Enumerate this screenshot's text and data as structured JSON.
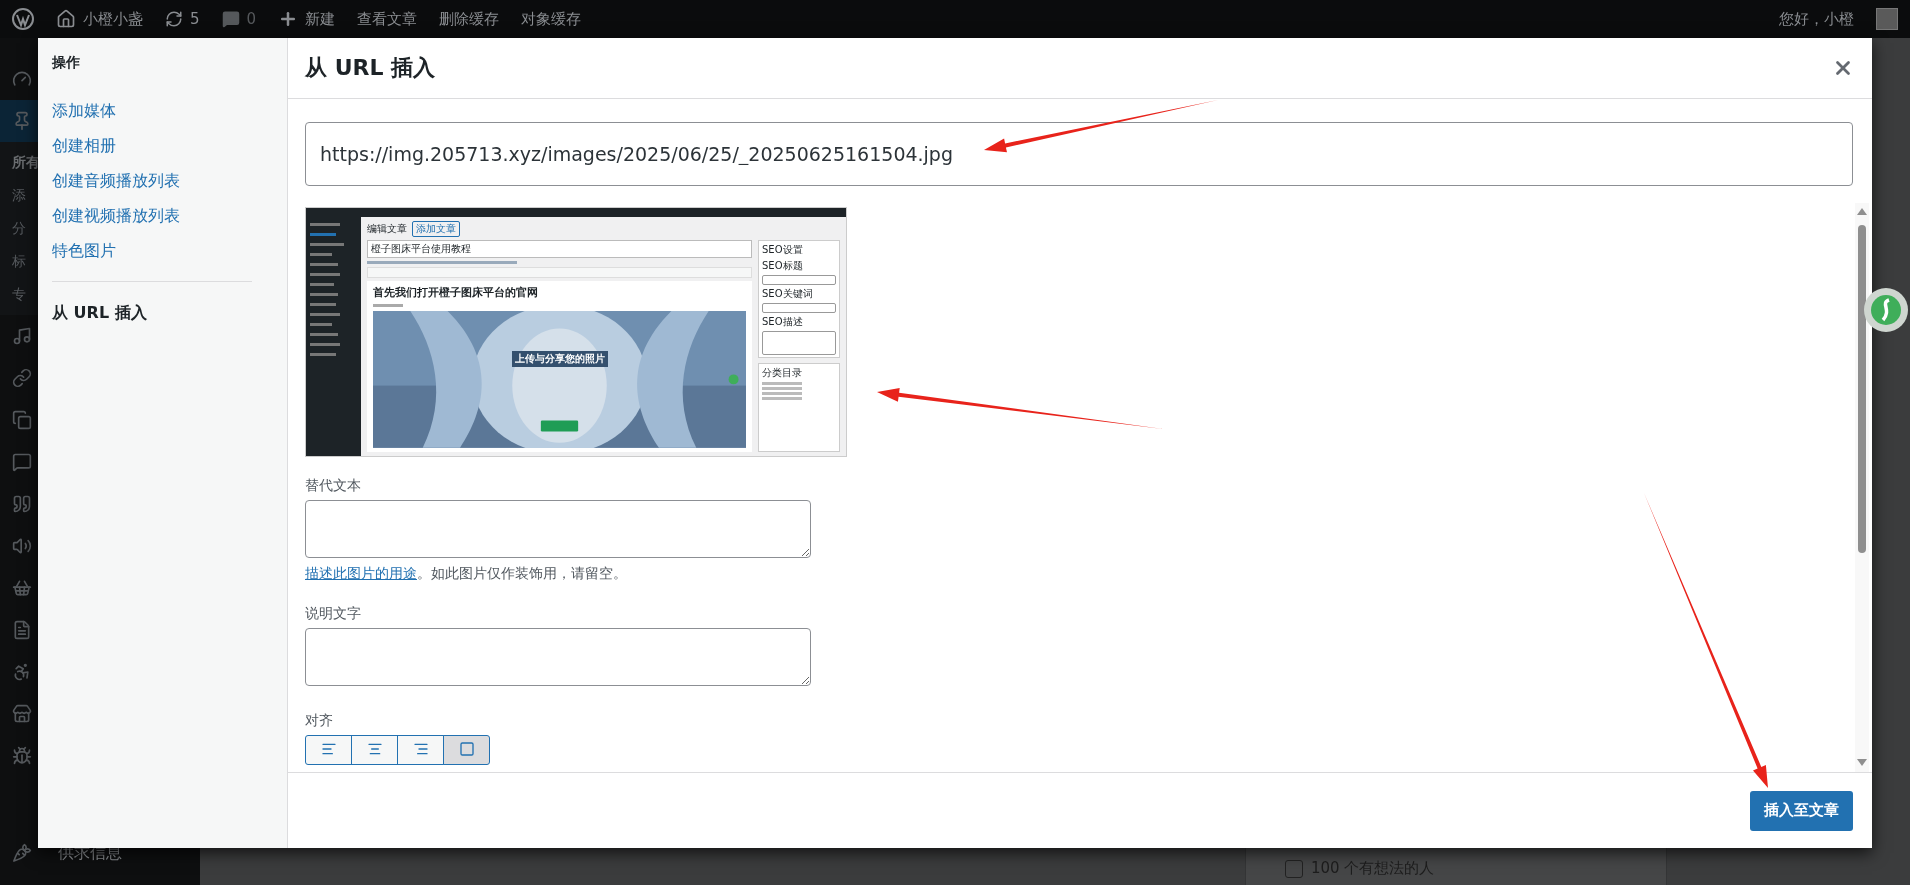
{
  "admin_bar": {
    "site": "小橙小盏",
    "updates": "5",
    "comments": "0",
    "new": "新建",
    "links": [
      "查看文章",
      "删除缓存",
      "对象缓存"
    ],
    "greeting": "您好，小橙"
  },
  "admin_menu": {
    "submenu": [
      "所有",
      "添",
      "分",
      "标",
      "专"
    ],
    "bottom_item": "供求信息"
  },
  "background_panel": {
    "checkbox_label": "100 个有想法的人",
    "checked": false
  },
  "modal": {
    "sidebar": {
      "heading": "操作",
      "groups": [
        {
          "items": [
            {
              "label": "添加媒体",
              "selected": false
            },
            {
              "label": "创建相册",
              "selected": false
            },
            {
              "label": "创建音频播放列表",
              "selected": false
            },
            {
              "label": "创建视频播放列表",
              "selected": false
            },
            {
              "label": "特色图片",
              "selected": false
            }
          ]
        },
        {
          "items": [
            {
              "label": "从 URL 插入",
              "selected": true
            }
          ]
        }
      ]
    },
    "title": "从 URL 插入",
    "url_value": "https://img.205713.xyz/images/2025/06/25/_20250625161504.jpg",
    "preview": {
      "page_title": "编辑文章",
      "add_button": "添加文章",
      "post_title": "橙子图床平台使用教程",
      "heading": "首先我们打开橙子图床平台的官网",
      "hero_text": "上传与分享您的照片",
      "seo_box": "SEO设置",
      "seo_fields": [
        "SEO标题",
        "SEO关键词",
        "SEO描述"
      ],
      "category_box": "分类目录"
    },
    "alt_text": {
      "label": "替代文本"
    },
    "alt_help": {
      "link": "描述此图片的用途",
      "text": "。如此图片仅作装饰用，请留空。"
    },
    "caption": {
      "label": "说明文字"
    },
    "align": {
      "label": "对齐",
      "options": [
        {
          "kind": "left",
          "selected": false
        },
        {
          "kind": "center",
          "selected": false
        },
        {
          "kind": "right",
          "selected": false
        },
        {
          "kind": "none",
          "selected": true
        }
      ]
    },
    "insert_button": "插入至文章"
  }
}
